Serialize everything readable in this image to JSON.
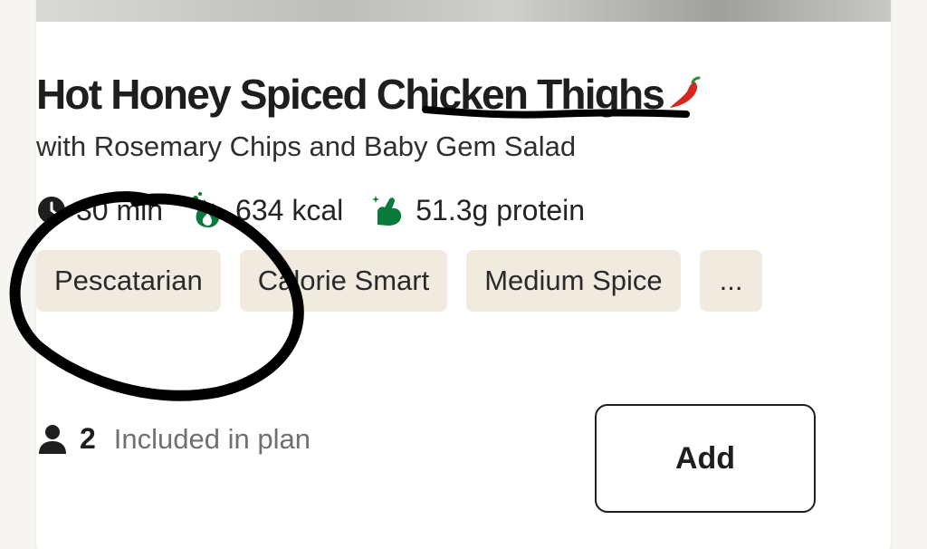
{
  "recipe": {
    "title": "Hot Honey Spiced Chicken Thighs",
    "subtitle": "with Rosemary Chips and Baby Gem Salad",
    "spice_icon": "chili-pepper-icon"
  },
  "stats": {
    "time": "30 min",
    "calories": "634 kcal",
    "protein": "51.3g protein"
  },
  "tags": [
    "Pescatarian",
    "Calorie Smart",
    "Medium Spice",
    "..."
  ],
  "footer": {
    "servings": "2",
    "status": "Included in plan"
  },
  "buttons": {
    "add_label": "Add"
  },
  "colors": {
    "tag_background": "#f1ebdf",
    "accent_green": "#0a7a3b",
    "chili_red": "#d7261e",
    "annotation_ink": "#000000"
  }
}
